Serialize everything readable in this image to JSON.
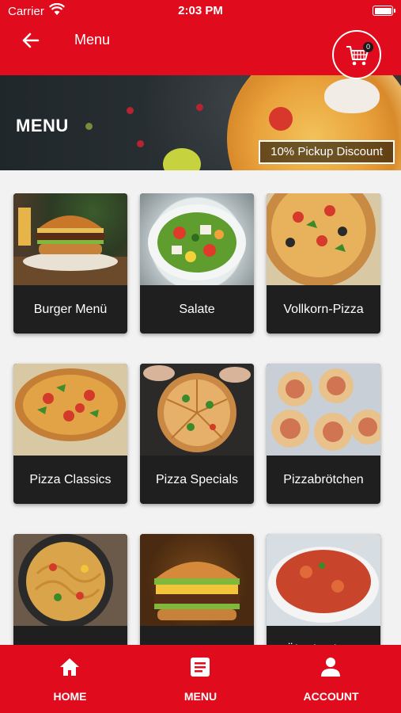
{
  "status_bar": {
    "carrier": "Carrier",
    "time": "2:03 PM"
  },
  "header": {
    "title": "Menu",
    "back_icon": "arrow-left-icon",
    "cart_icon": "cart-icon",
    "cart_count": "0"
  },
  "banner": {
    "title": "MENU",
    "badge": "10% Pickup Discount"
  },
  "categories": [
    {
      "label": "Burger Menü",
      "image": "burger"
    },
    {
      "label": "Salate",
      "image": "salad"
    },
    {
      "label": "Vollkorn-Pizza",
      "image": "pizza"
    },
    {
      "label": "Pizza Classics",
      "image": "pizza"
    },
    {
      "label": "Pizza Specials",
      "image": "pizza-slices"
    },
    {
      "label": "Pizzabrötchen",
      "image": "pizza-rolls"
    },
    {
      "label": "",
      "image": "noodles"
    },
    {
      "label": "",
      "image": "burger"
    },
    {
      "label": "Überbackene",
      "image": "baked-pasta"
    }
  ],
  "tabbar": [
    {
      "label": "HOME",
      "icon": "home-icon"
    },
    {
      "label": "MENU",
      "icon": "menu-icon"
    },
    {
      "label": "ACCOUNT",
      "icon": "person-icon"
    }
  ],
  "colors": {
    "brand": "#e00b1c",
    "card_label_bg": "#1f1f1f",
    "background": "#f2f2f2"
  }
}
